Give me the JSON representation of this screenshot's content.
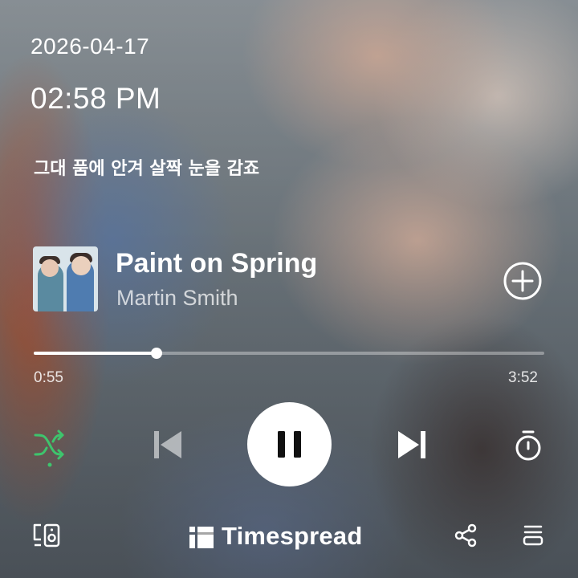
{
  "status": {
    "date": "2026-04-17",
    "time": "02:58 PM"
  },
  "lyrics": {
    "current_line": "그대 품에 안겨 살짝 눈을 감죠"
  },
  "track": {
    "title": "Paint on Spring",
    "artist": "Martin Smith",
    "elapsed": "0:55",
    "duration": "3:52",
    "progress_fraction": 0.24
  },
  "controls": {
    "shuffle": {
      "icon": "shuffle-icon",
      "active": true,
      "color": "#3ec46d"
    },
    "previous": {
      "icon": "skip-previous-icon"
    },
    "play_pause": {
      "icon": "pause-icon",
      "state": "playing"
    },
    "next": {
      "icon": "skip-next-icon"
    },
    "sleep_timer": {
      "icon": "timer-icon"
    },
    "add": {
      "icon": "add-circle-icon"
    }
  },
  "footer": {
    "brand_name": "Timespread",
    "device_icon": "device-connect-icon",
    "share_icon": "share-icon",
    "queue_icon": "queue-icon"
  },
  "colors": {
    "accent": "#3ec46d",
    "text": "#ffffff"
  }
}
